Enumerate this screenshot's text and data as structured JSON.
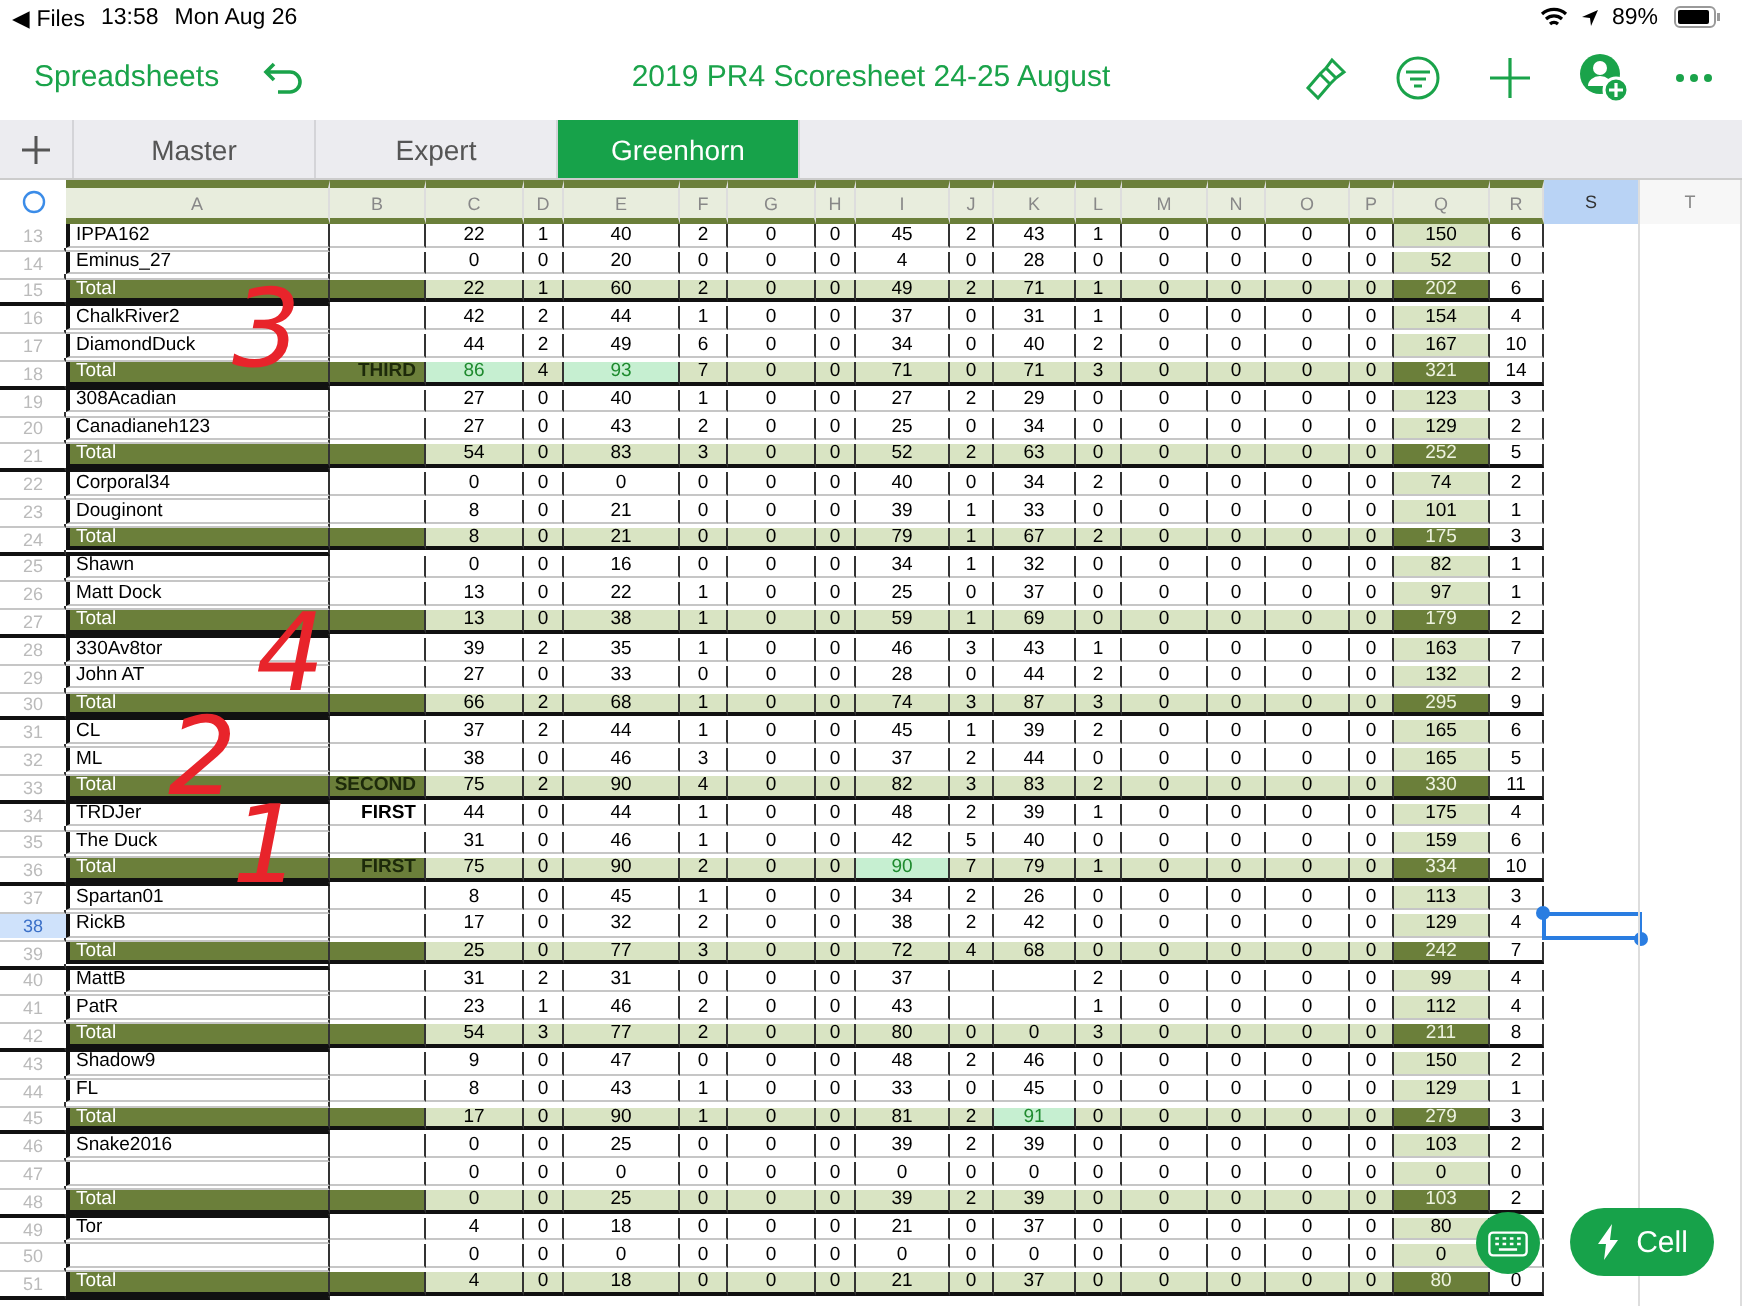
{
  "status_bar": {
    "back_app": "◀ Files",
    "time": "13:58",
    "date": "Mon Aug 26",
    "battery": "89%"
  },
  "toolbar": {
    "back_label": "Spreadsheets",
    "title": "2019 PR4 Scoresheet 24-25 August"
  },
  "tabs": [
    {
      "label": "Master",
      "selected": false
    },
    {
      "label": "Expert",
      "selected": false
    },
    {
      "label": "Greenhorn",
      "selected": true
    }
  ],
  "columns": [
    {
      "label": "A",
      "selected": false
    },
    {
      "label": "B",
      "selected": false
    },
    {
      "label": "C",
      "selected": false
    },
    {
      "label": "D",
      "selected": false
    },
    {
      "label": "E",
      "selected": false
    },
    {
      "label": "F",
      "selected": false
    },
    {
      "label": "G",
      "selected": false
    },
    {
      "label": "H",
      "selected": false
    },
    {
      "label": "I",
      "selected": false
    },
    {
      "label": "J",
      "selected": false
    },
    {
      "label": "K",
      "selected": false
    },
    {
      "label": "L",
      "selected": false
    },
    {
      "label": "M",
      "selected": false
    },
    {
      "label": "N",
      "selected": false
    },
    {
      "label": "O",
      "selected": false
    },
    {
      "label": "P",
      "selected": false
    },
    {
      "label": "Q",
      "selected": false
    },
    {
      "label": "R",
      "selected": false
    },
    {
      "label": "S",
      "selected": true
    },
    {
      "label": "T",
      "selected": false
    }
  ],
  "rows": [
    {
      "number": "13",
      "kind": "player",
      "selected": false,
      "name": "IPPA162",
      "cells": [
        "22",
        "1",
        "40",
        "2",
        "0",
        "0",
        "45",
        "2",
        "43",
        "1",
        "0",
        "0",
        "0",
        "0",
        "150",
        "6"
      ]
    },
    {
      "number": "14",
      "kind": "player",
      "selected": false,
      "name": "Eminus_27",
      "cells": [
        "0",
        "0",
        "20",
        "0",
        "0",
        "0",
        "4",
        "0",
        "28",
        "0",
        "0",
        "0",
        "0",
        "0",
        "52",
        "0"
      ]
    },
    {
      "number": "15",
      "kind": "total",
      "selected": false,
      "name": "Total",
      "cells": [
        "22",
        "1",
        "60",
        "2",
        "0",
        "0",
        "49",
        "2",
        "71",
        "1",
        "0",
        "0",
        "0",
        "0",
        "202",
        "6"
      ]
    },
    {
      "number": "16",
      "kind": "player",
      "selected": false,
      "name": "ChalkRiver2",
      "cells": [
        "42",
        "2",
        "44",
        "1",
        "0",
        "0",
        "37",
        "0",
        "31",
        "1",
        "0",
        "0",
        "0",
        "0",
        "154",
        "4"
      ]
    },
    {
      "number": "17",
      "kind": "player",
      "selected": false,
      "name": "DiamondDuck",
      "cells": [
        "44",
        "2",
        "49",
        "6",
        "0",
        "0",
        "34",
        "0",
        "40",
        "2",
        "0",
        "0",
        "0",
        "0",
        "167",
        "10"
      ]
    },
    {
      "number": "18",
      "kind": "total",
      "selected": false,
      "name": "Total",
      "note": "THIRD",
      "cells": [
        {
          "value": "86",
          "highlighted": true
        },
        "4",
        {
          "value": "93",
          "highlighted": true
        },
        "7",
        "0",
        "0",
        "71",
        "0",
        "71",
        "3",
        "0",
        "0",
        "0",
        "0",
        "321",
        "14"
      ]
    },
    {
      "number": "19",
      "kind": "player",
      "selected": false,
      "name": "308Acadian",
      "cells": [
        "27",
        "0",
        "40",
        "1",
        "0",
        "0",
        "27",
        "2",
        "29",
        "0",
        "0",
        "0",
        "0",
        "0",
        "123",
        "3"
      ]
    },
    {
      "number": "20",
      "kind": "player",
      "selected": false,
      "name": "Canadianeh123",
      "cells": [
        "27",
        "0",
        "43",
        "2",
        "0",
        "0",
        "25",
        "0",
        "34",
        "0",
        "0",
        "0",
        "0",
        "0",
        "129",
        "2"
      ]
    },
    {
      "number": "21",
      "kind": "total",
      "selected": false,
      "name": "Total",
      "cells": [
        "54",
        "0",
        "83",
        "3",
        "0",
        "0",
        "52",
        "2",
        "63",
        "0",
        "0",
        "0",
        "0",
        "0",
        "252",
        "5"
      ]
    },
    {
      "number": "22",
      "kind": "player",
      "selected": false,
      "name": "Corporal34",
      "cells": [
        "0",
        "0",
        "0",
        "0",
        "0",
        "0",
        "40",
        "0",
        "34",
        "2",
        "0",
        "0",
        "0",
        "0",
        "74",
        "2"
      ]
    },
    {
      "number": "23",
      "kind": "player",
      "selected": false,
      "name": "Douginont",
      "cells": [
        "8",
        "0",
        "21",
        "0",
        "0",
        "0",
        "39",
        "1",
        "33",
        "0",
        "0",
        "0",
        "0",
        "0",
        "101",
        "1"
      ]
    },
    {
      "number": "24",
      "kind": "total",
      "selected": false,
      "name": "Total",
      "cells": [
        "8",
        "0",
        "21",
        "0",
        "0",
        "0",
        "79",
        "1",
        "67",
        "2",
        "0",
        "0",
        "0",
        "0",
        "175",
        "3"
      ]
    },
    {
      "number": "25",
      "kind": "player",
      "selected": false,
      "name": "Shawn",
      "cells": [
        "0",
        "0",
        "16",
        "0",
        "0",
        "0",
        "34",
        "1",
        "32",
        "0",
        "0",
        "0",
        "0",
        "0",
        "82",
        "1"
      ]
    },
    {
      "number": "26",
      "kind": "player",
      "selected": false,
      "name": "Matt Dock",
      "cells": [
        "13",
        "0",
        "22",
        "1",
        "0",
        "0",
        "25",
        "0",
        "37",
        "0",
        "0",
        "0",
        "0",
        "0",
        "97",
        "1"
      ]
    },
    {
      "number": "27",
      "kind": "total",
      "selected": false,
      "name": "Total",
      "cells": [
        "13",
        "0",
        "38",
        "1",
        "0",
        "0",
        "59",
        "1",
        "69",
        "0",
        "0",
        "0",
        "0",
        "0",
        "179",
        "2"
      ]
    },
    {
      "number": "28",
      "kind": "player",
      "selected": false,
      "name": "330Av8tor",
      "cells": [
        "39",
        "2",
        "35",
        "1",
        "0",
        "0",
        "46",
        "3",
        "43",
        "1",
        "0",
        "0",
        "0",
        "0",
        "163",
        "7"
      ]
    },
    {
      "number": "29",
      "kind": "player",
      "selected": false,
      "name": "John AT",
      "cells": [
        "27",
        "0",
        "33",
        "0",
        "0",
        "0",
        "28",
        "0",
        "44",
        "2",
        "0",
        "0",
        "0",
        "0",
        "132",
        "2"
      ]
    },
    {
      "number": "30",
      "kind": "total",
      "selected": false,
      "name": "Total",
      "cells": [
        "66",
        "2",
        "68",
        "1",
        "0",
        "0",
        "74",
        "3",
        "87",
        "3",
        "0",
        "0",
        "0",
        "0",
        "295",
        "9"
      ]
    },
    {
      "number": "31",
      "kind": "player",
      "selected": false,
      "name": "CL",
      "cells": [
        "37",
        "2",
        "44",
        "1",
        "0",
        "0",
        "45",
        "1",
        "39",
        "2",
        "0",
        "0",
        "0",
        "0",
        "165",
        "6"
      ]
    },
    {
      "number": "32",
      "kind": "player",
      "selected": false,
      "name": "ML",
      "cells": [
        "38",
        "0",
        "46",
        "3",
        "0",
        "0",
        "37",
        "2",
        "44",
        "0",
        "0",
        "0",
        "0",
        "0",
        "165",
        "5"
      ]
    },
    {
      "number": "33",
      "kind": "total",
      "selected": false,
      "name": "Total",
      "note": "SECOND",
      "cells": [
        "75",
        "2",
        "90",
        "4",
        "0",
        "0",
        "82",
        "3",
        "83",
        "2",
        "0",
        "0",
        "0",
        "0",
        "330",
        "11"
      ]
    },
    {
      "number": "34",
      "kind": "player",
      "selected": false,
      "name": "TRDJer",
      "note": "FIRST",
      "cells": [
        "44",
        "0",
        "44",
        "1",
        "0",
        "0",
        "48",
        "2",
        "39",
        "1",
        "0",
        "0",
        "0",
        "0",
        "175",
        "4"
      ]
    },
    {
      "number": "35",
      "kind": "player",
      "selected": false,
      "name": "The Duck",
      "cells": [
        "31",
        "0",
        "46",
        "1",
        "0",
        "0",
        "42",
        "5",
        "40",
        "0",
        "0",
        "0",
        "0",
        "0",
        "159",
        "6"
      ]
    },
    {
      "number": "36",
      "kind": "total",
      "selected": false,
      "name": "Total",
      "note": "FIRST",
      "cells": [
        "75",
        "0",
        "90",
        "2",
        "0",
        "0",
        {
          "value": "90",
          "highlighted": true
        },
        "7",
        "79",
        "1",
        "0",
        "0",
        "0",
        "0",
        "334",
        "10"
      ]
    },
    {
      "number": "37",
      "kind": "player",
      "selected": false,
      "name": "Spartan01",
      "cells": [
        "8",
        "0",
        "45",
        "1",
        "0",
        "0",
        "34",
        "2",
        "26",
        "0",
        "0",
        "0",
        "0",
        "0",
        "113",
        "3"
      ]
    },
    {
      "number": "38",
      "kind": "player",
      "selected": true,
      "name": "RickB",
      "cells": [
        "17",
        "0",
        "32",
        "2",
        "0",
        "0",
        "38",
        "2",
        "42",
        "0",
        "0",
        "0",
        "0",
        "0",
        "129",
        "4"
      ]
    },
    {
      "number": "39",
      "kind": "total",
      "selected": false,
      "name": "Total",
      "cells": [
        "25",
        "0",
        "77",
        "3",
        "0",
        "0",
        "72",
        "4",
        "68",
        "0",
        "0",
        "0",
        "0",
        "0",
        "242",
        "7"
      ]
    },
    {
      "number": "40",
      "kind": "player",
      "selected": false,
      "name": "MattB",
      "cells": [
        "31",
        "2",
        "31",
        "0",
        "0",
        "0",
        "37",
        null,
        null,
        "2",
        "0",
        "0",
        "0",
        "0",
        "99",
        "4"
      ]
    },
    {
      "number": "41",
      "kind": "player",
      "selected": false,
      "name": "PatR",
      "cells": [
        "23",
        "1",
        "46",
        "2",
        "0",
        "0",
        "43",
        null,
        null,
        "1",
        "0",
        "0",
        "0",
        "0",
        "112",
        "4"
      ]
    },
    {
      "number": "42",
      "kind": "total",
      "selected": false,
      "name": "Total",
      "cells": [
        "54",
        "3",
        "77",
        "2",
        "0",
        "0",
        "80",
        "0",
        "0",
        "3",
        "0",
        "0",
        "0",
        "0",
        "211",
        "8"
      ]
    },
    {
      "number": "43",
      "kind": "player",
      "selected": false,
      "name": "Shadow9",
      "cells": [
        "9",
        "0",
        "47",
        "0",
        "0",
        "0",
        "48",
        "2",
        "46",
        "0",
        "0",
        "0",
        "0",
        "0",
        "150",
        "2"
      ]
    },
    {
      "number": "44",
      "kind": "player",
      "selected": false,
      "name": "FL",
      "cells": [
        "8",
        "0",
        "43",
        "1",
        "0",
        "0",
        "33",
        "0",
        "45",
        "0",
        "0",
        "0",
        "0",
        "0",
        "129",
        "1"
      ]
    },
    {
      "number": "45",
      "kind": "total",
      "selected": false,
      "name": "Total",
      "cells": [
        "17",
        "0",
        "90",
        "1",
        "0",
        "0",
        "81",
        "2",
        {
          "value": "91",
          "highlighted": true
        },
        "0",
        "0",
        "0",
        "0",
        "0",
        "279",
        "3"
      ]
    },
    {
      "number": "46",
      "kind": "player",
      "selected": false,
      "name": "Snake2016",
      "cells": [
        "0",
        "0",
        "25",
        "0",
        "0",
        "0",
        "39",
        "2",
        "39",
        "0",
        "0",
        "0",
        "0",
        "0",
        "103",
        "2"
      ]
    },
    {
      "number": "47",
      "kind": "player",
      "selected": false,
      "cells": [
        "0",
        "0",
        "0",
        "0",
        "0",
        "0",
        "0",
        "0",
        "0",
        "0",
        "0",
        "0",
        "0",
        "0",
        "0",
        "0"
      ]
    },
    {
      "number": "48",
      "kind": "total",
      "selected": false,
      "name": "Total",
      "cells": [
        "0",
        "0",
        "25",
        "0",
        "0",
        "0",
        "39",
        "2",
        "39",
        "0",
        "0",
        "0",
        "0",
        "0",
        "103",
        "2"
      ]
    },
    {
      "number": "49",
      "kind": "player",
      "selected": false,
      "name": "Tor",
      "cells": [
        "4",
        "0",
        "18",
        "0",
        "0",
        "0",
        "21",
        "0",
        "37",
        "0",
        "0",
        "0",
        "0",
        "0",
        "80"
      ]
    },
    {
      "number": "50",
      "kind": "player",
      "selected": false,
      "cells": [
        "0",
        "0",
        "0",
        "0",
        "0",
        "0",
        "0",
        "0",
        "0",
        "0",
        "0",
        "0",
        "0",
        "0",
        "0"
      ]
    },
    {
      "number": "51",
      "kind": "total",
      "selected": false,
      "name": "Total",
      "cells": [
        "4",
        "0",
        "18",
        "0",
        "0",
        "0",
        "21",
        "0",
        "37",
        "0",
        "0",
        "0",
        "0",
        "0",
        "80",
        "0"
      ]
    }
  ],
  "annotations": [
    {
      "text": "3"
    },
    {
      "text": "4"
    },
    {
      "text": "2"
    },
    {
      "text": "1"
    }
  ],
  "cell_button": {
    "label": "Cell"
  }
}
